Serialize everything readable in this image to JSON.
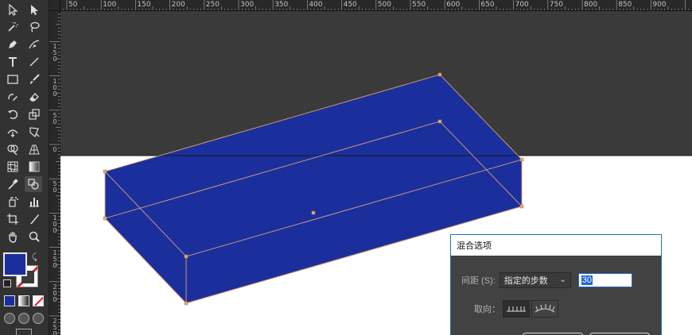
{
  "horizontal_ruler": {
    "labels": [
      "50",
      "100",
      "150",
      "200",
      "250",
      "300",
      "350",
      "400",
      "450",
      "500",
      "550",
      "600",
      "650",
      "700",
      "750",
      "800",
      "850",
      "900"
    ]
  },
  "vertical_ruler": {
    "labels": [
      "1 5 0",
      "1 0 0",
      "5 0",
      "0",
      "5 0",
      "1 0 0",
      "1 5 0",
      "2 0 0",
      "2 5 0"
    ]
  },
  "toolbar": {
    "tools": [
      "selection-tool",
      "direct-selection-tool",
      "magic-wand-tool",
      "lasso-tool",
      "pen-tool",
      "curvature-tool",
      "type-tool",
      "line-segment-tool",
      "rectangle-tool",
      "paintbrush-tool",
      "shaper-tool",
      "eraser-tool",
      "rotate-tool",
      "scale-tool",
      "width-tool",
      "free-transform-tool",
      "shape-builder-tool",
      "perspective-grid-tool",
      "mesh-tool",
      "gradient-tool",
      "eyedropper-tool",
      "blend-tool",
      "symbol-sprayer-tool",
      "column-graph-tool",
      "artboard-tool",
      "slice-tool",
      "hand-tool",
      "zoom-tool"
    ],
    "fill_color": "#1b2f9c",
    "stroke_color": "none"
  },
  "artwork": {
    "fill_color": "#1b2f9c",
    "path_color": "#d9a27a"
  },
  "dialog": {
    "title": "混合选项",
    "spacing_label": "间距 (S):",
    "spacing_value": "指定的步数",
    "steps_value": "30",
    "orientation_label": "取向："
  }
}
